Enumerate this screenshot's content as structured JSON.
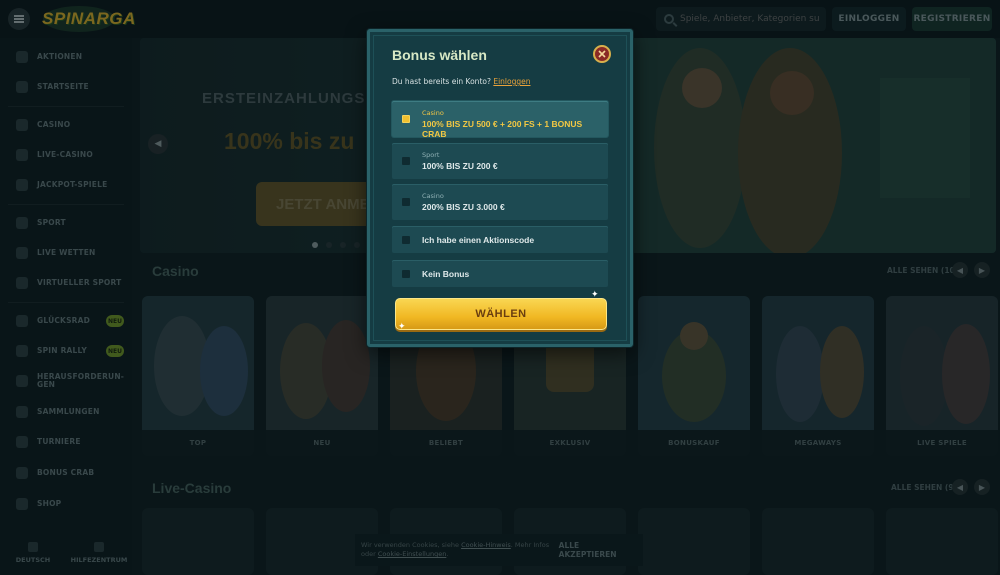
{
  "topbar": {
    "logo_text": "SPINARGA",
    "search_placeholder": "Spiele, Anbieter, Kategorien suchen",
    "login_label": "EINLOGGEN",
    "register_label": "REGISTRIEREN"
  },
  "sidebar": {
    "items": [
      {
        "label": "AKTIONEN"
      },
      {
        "label": "STARTSEITE"
      },
      {
        "label": "CASINO"
      },
      {
        "label": "LIVE-CASINO"
      },
      {
        "label": "JACKPOT-SPIELE"
      },
      {
        "label": "SPORT"
      },
      {
        "label": "LIVE WETTEN"
      },
      {
        "label": "VIRTUELLER SPORT"
      },
      {
        "label": "GLÜCKSRAD",
        "badge": "NEU"
      },
      {
        "label": "SPIN RALLY",
        "badge": "NEU"
      },
      {
        "label": "HERAUSFORDERUN-GEN"
      },
      {
        "label": "SAMMLUNGEN"
      },
      {
        "label": "TURNIERE"
      },
      {
        "label": "BONUS CRAB"
      },
      {
        "label": "SHOP"
      }
    ],
    "bottom": {
      "language": "DEUTSCH",
      "help": "HILFEZENTRUM"
    }
  },
  "hero": {
    "subtitle": "ERSTEINZAHLUNGS-S",
    "title": "100% bis zu",
    "cta": "JETZT ANMELD"
  },
  "casino_section": {
    "title": "Casino",
    "see_all": "ALLE SEHEN (10)",
    "cards": [
      "TOP",
      "NEU",
      "BELIEBT",
      "EXKLUSIV",
      "BONUSKAUF",
      "MEGAWAYS",
      "LIVE SPIELE"
    ]
  },
  "live_section": {
    "title": "Live-Casino",
    "see_all": "ALLE SEHEN (9)"
  },
  "cookie": {
    "text_pre": "Wir verwenden Cookies, siehe",
    "link1": "Cookie-Hinweis",
    "text_mid": ". Mehr Infos oder",
    "link2": "Cookie-Einstellungen",
    "accept": "ALLE AKZEPTIEREN"
  },
  "modal": {
    "title": "Bonus wählen",
    "account_question": "Du hast bereits ein Konto?",
    "login_link": "Einloggen",
    "options": [
      {
        "category": "Casino",
        "value": "100% BIS ZU 500 € + 200 FS + 1 BONUS CRAB",
        "selected": true
      },
      {
        "category": "Sport",
        "value": "100% BIS ZU 200 €",
        "selected": false
      },
      {
        "category": "Casino",
        "value": "200% BIS ZU 3.000 €",
        "selected": false
      },
      {
        "category": "",
        "value": "Ich habe einen Aktionscode",
        "selected": false
      },
      {
        "category": "",
        "value": "Kein Bonus",
        "selected": false
      }
    ],
    "choose_label": "WÄHLEN"
  },
  "colors": {
    "accent_yellow": "#f1c02f",
    "modal_bg": "#153c43",
    "link_orange": "#e8a23a",
    "close_red": "#8a2a26"
  }
}
